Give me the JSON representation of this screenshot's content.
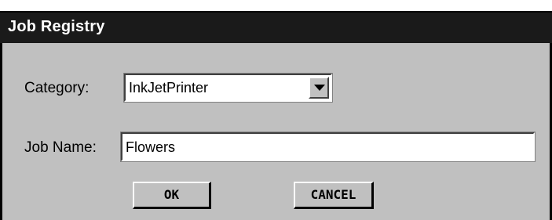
{
  "window": {
    "title": "Job Registry"
  },
  "form": {
    "category_label": "Category:",
    "category_value": "InkJetPrinter",
    "jobname_label": "Job Name:",
    "jobname_value": "Flowers"
  },
  "buttons": {
    "ok_label": "OK",
    "cancel_label": "CANCEL"
  },
  "colors": {
    "titlebar": "#1a1a1a",
    "dialog_bg": "#c0c0c0",
    "field_bg": "#ffffff"
  },
  "icons": {
    "dropdown": "chevron-down-icon"
  }
}
